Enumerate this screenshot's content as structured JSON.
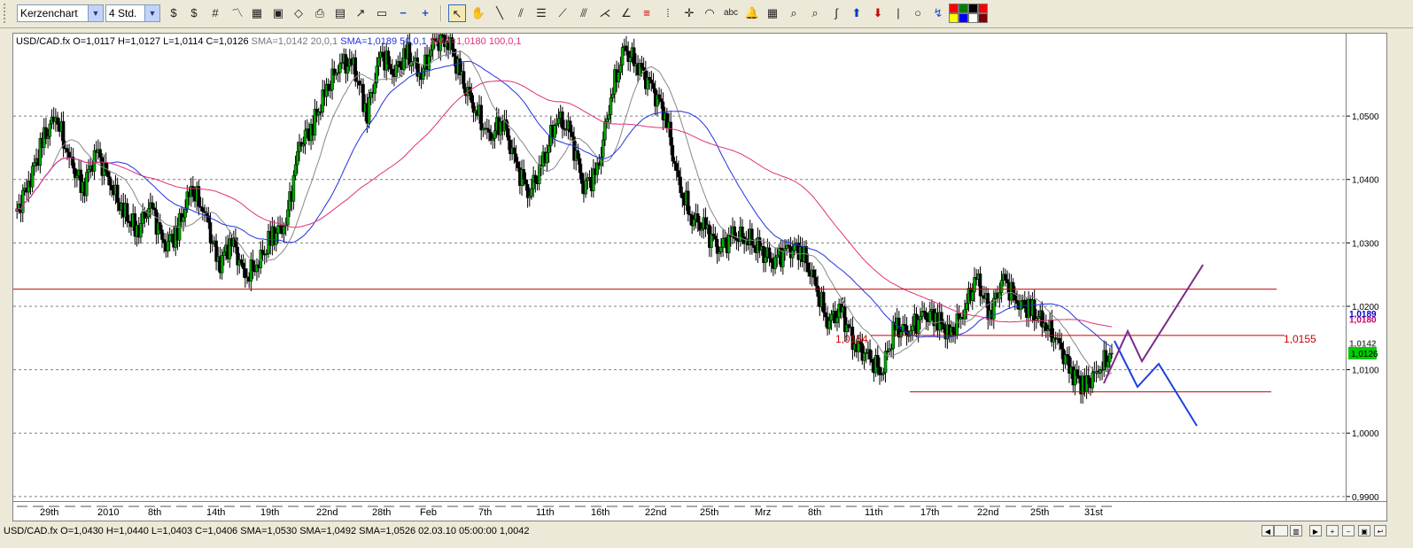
{
  "toolbar": {
    "chart_type_value": "Kerzenchart",
    "timeframe_value": "4 Std.",
    "palette": [
      "#ff0000",
      "#008000",
      "#000000",
      "#ff0000",
      "#ffff00",
      "#0000ff",
      "#ffffff",
      "#800000"
    ]
  },
  "chart": {
    "header": {
      "symbol": "USD/CAD.fx",
      "ohlc": "O=1,0117 H=1,0127 L=1,0114 C=1,0126",
      "sma1": "SMA=1,0142",
      "sma1_params": "20,0,1",
      "sma2": "SMA=1,0189",
      "sma2_params": "50,0,1",
      "sma3": "SMA=1,0180",
      "sma3_params": "100,0,1"
    },
    "line_labels": {
      "left": "1,0154",
      "right": "1,0155"
    }
  },
  "chart_data": {
    "type": "candlestick",
    "symbol": "USD/CAD.fx",
    "timeframe": "4 Std.",
    "y_ticks": [
      "1,0500",
      "1,0400",
      "1,0300",
      "1,0200",
      "1,0100",
      "1,0000",
      "0,9900"
    ],
    "y_tick_values": [
      1.05,
      1.04,
      1.03,
      1.02,
      1.01,
      1.0,
      0.99
    ],
    "ylim": [
      0.989,
      1.063
    ],
    "x_ticks": [
      "29th",
      "2010",
      "8th",
      "14th",
      "19th",
      "22nd",
      "28th",
      "Feb",
      "7th",
      "11th",
      "16th",
      "22nd",
      "25th",
      "Mrz",
      "8th",
      "11th",
      "17th",
      "22nd",
      "25th",
      "31st"
    ],
    "price_markers": [
      {
        "label": "1,0189",
        "value": 1.0189,
        "color": "#0000cc"
      },
      {
        "label": "1,0180",
        "value": 1.018,
        "color": "#cc0066"
      },
      {
        "label": "1,0142",
        "value": 1.0142,
        "color": "#555555"
      },
      {
        "label": "1,0126",
        "value": 1.0126,
        "color": "#00cc00",
        "highlight": true
      }
    ],
    "indicators": [
      {
        "name": "SMA 20",
        "value": 1.0142,
        "color": "#888888"
      },
      {
        "name": "SMA 50",
        "value": 1.0189,
        "color": "#2233dd"
      },
      {
        "name": "SMA 100",
        "value": 1.018,
        "color": "#e0307a"
      }
    ],
    "horizontal_lines": [
      {
        "value": 1.0227,
        "color": "#cc0000"
      },
      {
        "value": 1.0154,
        "color": "#cc0000",
        "label": "1,0154"
      },
      {
        "value": 1.0065,
        "color": "#cc0000"
      }
    ],
    "price_path": [
      1.0342,
      1.0395,
      1.0458,
      1.0502,
      1.0432,
      1.0386,
      1.0445,
      1.0395,
      1.0349,
      1.0318,
      1.0361,
      1.0296,
      1.0318,
      1.0386,
      1.0349,
      1.0265,
      1.0305,
      1.0245,
      1.027,
      1.031,
      1.0332,
      1.0454,
      1.0487,
      1.054,
      1.0585,
      1.0578,
      1.0505,
      1.0597,
      1.0571,
      1.0597,
      1.0567,
      1.0616,
      1.0622,
      1.0555,
      1.0513,
      1.0462,
      1.0496,
      1.042,
      1.0381,
      1.0424,
      1.0501,
      1.0471,
      1.0392,
      1.0408,
      1.0534,
      1.0602,
      1.0584,
      1.0542,
      1.0508,
      1.0388,
      1.0342,
      1.0319,
      1.0295,
      1.0308,
      1.0312,
      1.0285,
      1.0275,
      1.0286,
      1.0294,
      1.0236,
      1.0179,
      1.019,
      1.0143,
      1.0118,
      1.0098,
      1.0165,
      1.0163,
      1.0183,
      1.0186,
      1.0151,
      1.0191,
      1.0243,
      1.0189,
      1.0243,
      1.0208,
      1.0193,
      1.0175,
      1.0143,
      1.0098,
      1.0072,
      1.01,
      1.0126
    ]
  },
  "projections": {
    "blue": [
      [
        1257,
        384
      ],
      [
        1283,
        436
      ],
      [
        1307,
        410
      ],
      [
        1350,
        480
      ]
    ],
    "purple": [
      [
        1245,
        432
      ],
      [
        1272,
        373
      ],
      [
        1288,
        407
      ],
      [
        1357,
        298
      ]
    ]
  },
  "status": {
    "text": "USD/CAD.fx O=1,0430 H=1,0440 L=1,0403 C=1,0406  SMA=1,0530 SMA=1,0492 SMA=1,0526  02.03.10 05:00:00 1,0042"
  }
}
